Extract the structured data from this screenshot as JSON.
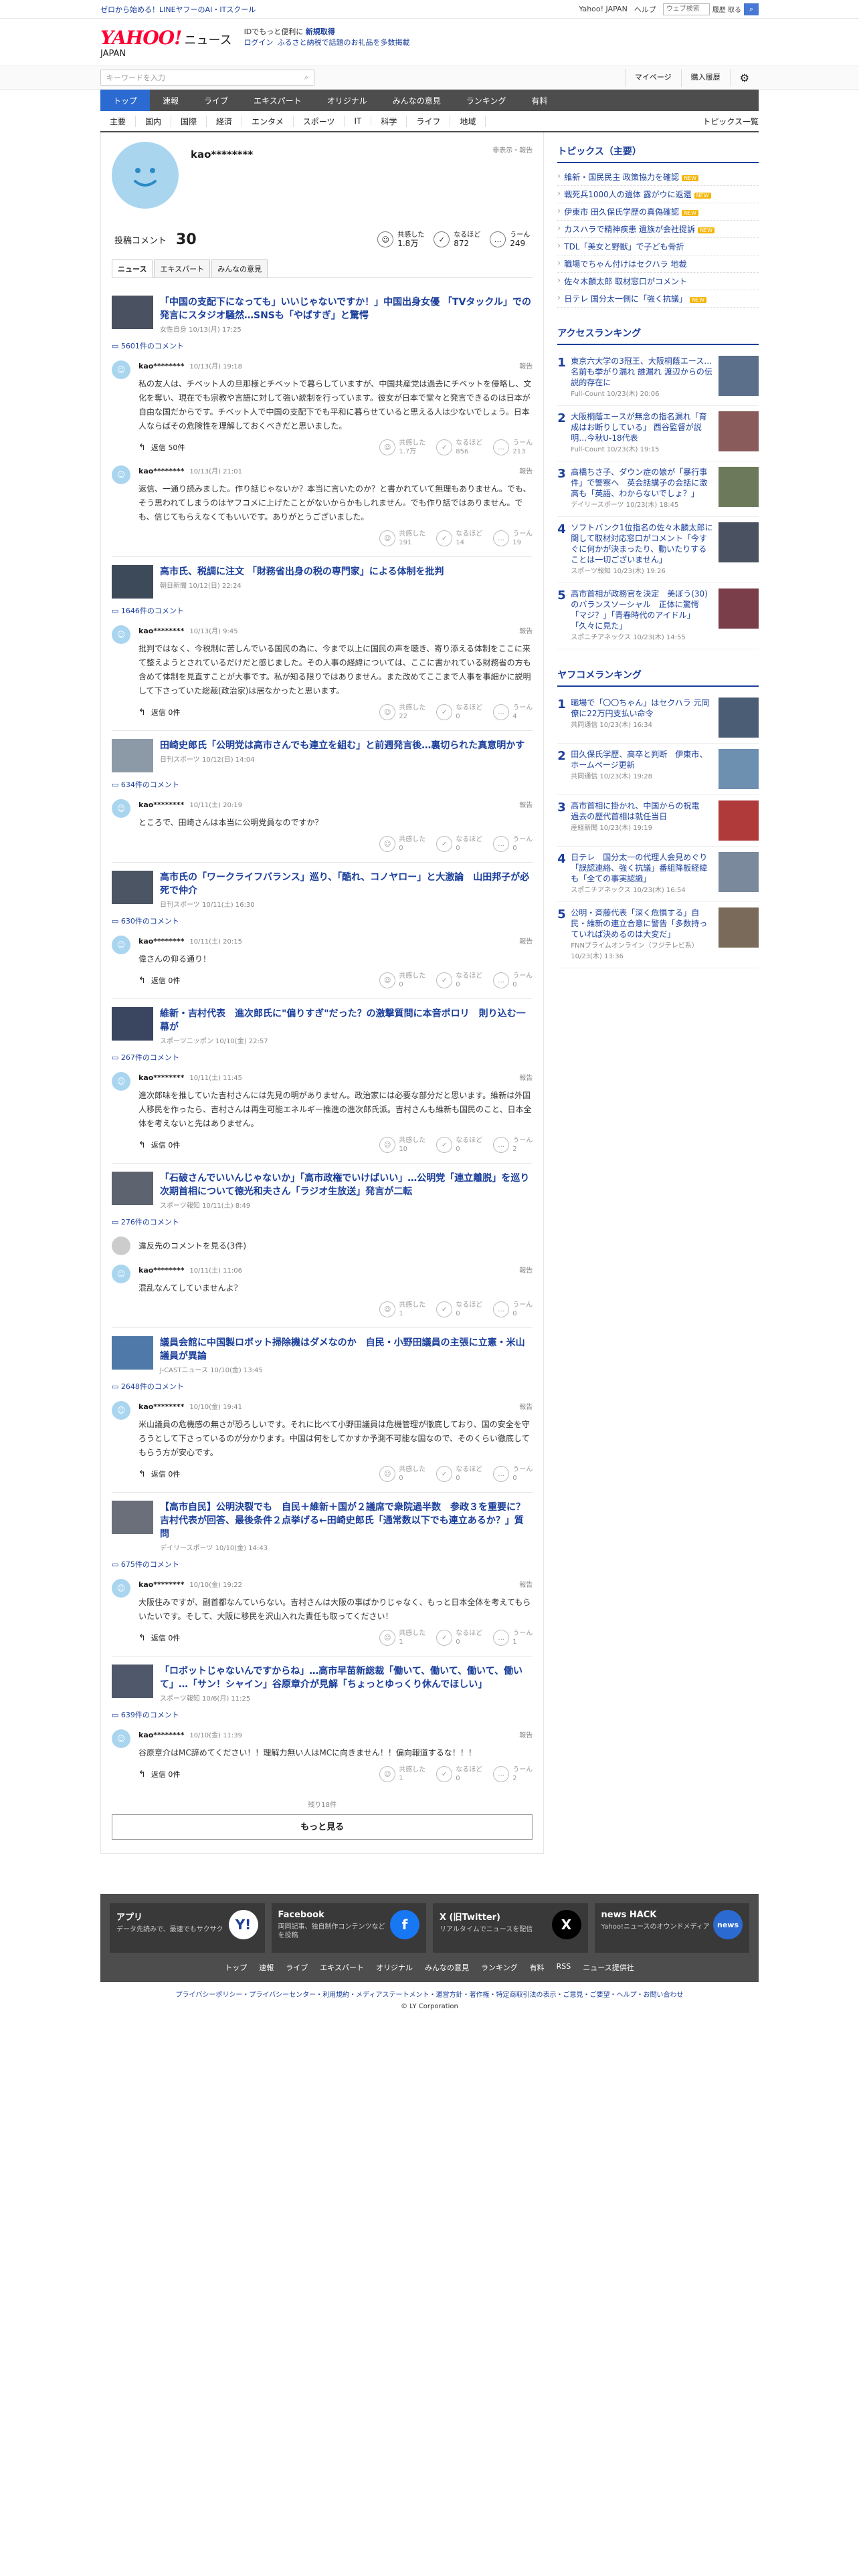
{
  "topbar": {
    "promo": "ゼロから始める！LINEヤフーのAI・ITスクール",
    "yahoo_japan": "Yahoo! JAPAN",
    "help": "ヘルプ",
    "search_placeholder": "ウェブ検索",
    "option": "履歴 取る"
  },
  "header": {
    "logo": "YAHOO!",
    "logo_sub": "JAPAN",
    "news": "ニュース",
    "promo_line1_a": "IDでもっと便利に",
    "promo_line1_b": "新規取得",
    "login": "ログイン",
    "promo_line2": "ふるさと納税で話題のお礼品を多数掲載"
  },
  "search": {
    "placeholder": "キーワードを入力",
    "mypage": "マイページ",
    "history": "購入履歴"
  },
  "nav_primary": [
    "トップ",
    "速報",
    "ライブ",
    "エキスパート",
    "オリジナル",
    "みんなの意見",
    "ランキング",
    "有料"
  ],
  "nav_secondary": [
    "主要",
    "国内",
    "国際",
    "経済",
    "エンタメ",
    "スポーツ",
    "IT",
    "科学",
    "ライフ",
    "地域"
  ],
  "nav_topics": "トピックス一覧",
  "profile": {
    "name": "kao********",
    "report": "非表示・報告",
    "posted_label": "投稿コメント",
    "posted_count": "30",
    "reactions": [
      {
        "icon": "☺",
        "label": "共感した",
        "value": "1.8万"
      },
      {
        "icon": "✓",
        "label": "なるほど",
        "value": "872"
      },
      {
        "icon": "…",
        "label": "うーん",
        "value": "249"
      }
    ],
    "tabs": [
      "ニュース",
      "エキスパート",
      "みんなの意見"
    ]
  },
  "articles": [
    {
      "title": "「中国の支配下になっても」いいじゃないですか！」中国出身女優 「TVタックル」での発言にスタジオ騒然…SNSも「やばすぎ」と驚愕",
      "meta": "女性自身 10/13(月) 17:25",
      "comment_count": "5601件のコメント",
      "comments": [
        {
          "user": "kao********",
          "time": "10/13(月) 19:18",
          "text": "私の友人は、チベット人の旦那様とチベットで暮らしていますが、中国共産党は過去にチベットを侵略し、文化を奪い、現在でも宗教や言語に対して強い統制を行っています。彼女が日本で堂々と発言できるのは日本が自由な国だからです。チベット人で中国の支配下でも平和に暮らせていると思える人は少ないでしょう。日本人ならばその危険性を理解しておくべきだと思いました。",
          "reply": "返信 50件",
          "votes": [
            {
              "l": "共感した",
              "v": "1.7万"
            },
            {
              "l": "なるほど",
              "v": "856"
            },
            {
              "l": "うーん",
              "v": "213"
            }
          ]
        },
        {
          "user": "kao********",
          "time": "10/13(月) 21:01",
          "text": "返信、一通り読みました。作り話じゃないか？本当に言いたのか？と書かれていて無理もありません。でも、そう思われてしまうのはヤフコメに上げたことがないからかもしれません。でも作り話ではありません。でも、信じてもらえなくてもいいです。ありがとうございました。",
          "reply": "",
          "votes": [
            {
              "l": "共感した",
              "v": "191"
            },
            {
              "l": "なるほど",
              "v": "14"
            },
            {
              "l": "うーん",
              "v": "19"
            }
          ]
        }
      ]
    },
    {
      "title": "高市氏、税調に注文 「財務省出身の税の専門家」による体制を批判",
      "meta": "朝日新聞 10/12(日) 22:24",
      "comment_count": "1646件のコメント",
      "comments": [
        {
          "user": "kao********",
          "time": "10/13(月) 9:45",
          "text": "批判ではなく、今税制に苦しんでいる国民の為に、今まで以上に国民の声を聴き、寄り添える体制をここに来て整えようとされているだけだと感じました。その人事の経緯については、ここに書かれている財務省の方も含めて体制を見直すことが大事です。私が知る限りではありません。また改めてここまで人事を事細かに説明して下さっていた総裁(政治家)は居なかったと思います。",
          "reply": "返信 0件",
          "votes": [
            {
              "l": "共感した",
              "v": "22"
            },
            {
              "l": "なるほど",
              "v": "0"
            },
            {
              "l": "うーん",
              "v": "4"
            }
          ]
        }
      ]
    },
    {
      "title": "田崎史郎氏「公明党は高市さんでも連立を組む」と前週発言後…裏切られた真意明かす",
      "meta": "日刊スポーツ 10/12(日) 14:04",
      "comment_count": "634件のコメント",
      "comments": [
        {
          "user": "kao********",
          "time": "10/11(土) 20:19",
          "text": "ところで、田崎さんは本当に公明党員なのですか？",
          "reply": "",
          "votes": [
            {
              "l": "共感した",
              "v": "0"
            },
            {
              "l": "なるほど",
              "v": "0"
            },
            {
              "l": "うーん",
              "v": "0"
            }
          ]
        }
      ]
    },
    {
      "title": "高市氏の「ワークライフバランス」巡り、「酷れ、コノヤロー」と大激論　山田邦子が必死で仲介",
      "meta": "日刊スポーツ 10/11(土) 16:30",
      "comment_count": "630件のコメント",
      "comments": [
        {
          "user": "kao********",
          "time": "10/11(土) 20:15",
          "text": "偉さんの仰る通り！",
          "reply": "返信 0件",
          "votes": [
            {
              "l": "共感した",
              "v": "0"
            },
            {
              "l": "なるほど",
              "v": "0"
            },
            {
              "l": "うーん",
              "v": "0"
            }
          ]
        }
      ]
    },
    {
      "title": "維新・吉村代表　進次郎氏に\"偏りすぎ\"だった？の激撃質問に本音ポロリ　則り込む一幕が",
      "meta": "スポーツニッポン 10/10(金) 22:57",
      "comment_count": "267件のコメント",
      "comments": [
        {
          "user": "kao********",
          "time": "10/11(土) 11:45",
          "text": "進次郎味を推していた吉村さんには先見の明がありません。政治家には必要な部分だと思います。維新は外国人移民を作ったら、吉村さんは再生可能エネルギー推進の進次郎氏派。吉村さんも維新も国民のこと、日本全体を考えないと先はありません。",
          "reply": "返信 0件",
          "votes": [
            {
              "l": "共感した",
              "v": "10"
            },
            {
              "l": "なるほど",
              "v": "0"
            },
            {
              "l": "うーん",
              "v": "2"
            }
          ]
        }
      ]
    },
    {
      "title": "「石破さんでいいんじゃないか」「高市政権でいけばいい」…公明党「連立離脱」を巡り次期首相について徳光和夫さん「ラジオ生放送」発言が二転",
      "meta": "スポーツ報知 10/11(土) 8:49",
      "comment_count": "276件のコメント",
      "comments": [
        {
          "user": "kao********",
          "time": "10/11(土) 11:06",
          "text": "混乱なんてしていませんよ？",
          "reply": "",
          "hidden_note": "違反先のコメントを見る(3件)",
          "votes": [
            {
              "l": "共感した",
              "v": "1"
            },
            {
              "l": "なるほど",
              "v": "0"
            },
            {
              "l": "うーん",
              "v": "0"
            }
          ]
        }
      ]
    },
    {
      "title": "議員会館に中国製ロボット掃除機はダメなのか　自民・小野田議員の主張に立憲・米山議員が異論",
      "meta": "J-CASTニュース 10/10(金) 13:45",
      "comment_count": "2648件のコメント",
      "comments": [
        {
          "user": "kao********",
          "time": "10/10(金) 19:41",
          "text": "米山議員の危機感の無さが恐ろしいです。それに比べて小野田議員は危機管理が徹底しており、国の安全を守ろうとして下さっているのが分かります。中国は何をしてかすか予測不可能な国なので、そのくらい徹底してもらう方が安心です。",
          "reply": "返信 0件",
          "votes": [
            {
              "l": "共感した",
              "v": "0"
            },
            {
              "l": "なるほど",
              "v": "0"
            },
            {
              "l": "うーん",
              "v": "0"
            }
          ]
        }
      ]
    },
    {
      "title": "【高市自民】公明決裂でも　自民＋維新＋国が２議席で衆院過半数　参政３を重要に？　吉村代表が回答、最後条件２点挙げる←田崎史郎氏「通常数以下でも連立あるか？」質問",
      "meta": "デイリースポーツ 10/10(金) 14:43",
      "comment_count": "675件のコメント",
      "comments": [
        {
          "user": "kao********",
          "time": "10/10(金) 19:22",
          "text": "大阪住みですが、副首都なんていらない。吉村さんは大阪の事ばかりじゃなく、もっと日本全体を考えてもらいたいです。そして、大阪に移民を沢山入れた責任も取ってください！",
          "reply": "返信 0件",
          "votes": [
            {
              "l": "共感した",
              "v": "1"
            },
            {
              "l": "なるほど",
              "v": "0"
            },
            {
              "l": "うーん",
              "v": "1"
            }
          ]
        }
      ]
    },
    {
      "title": "「ロボットじゃないんですからね」…高市早苗新総裁「働いて、働いて、働いて、働いて」…「サン！シャイン」谷原章介が見解「ちょっとゆっくり休んでほしい」",
      "meta": "スポーツ報知 10/6(月) 11:25",
      "comment_count": "639件のコメント",
      "comments": [
        {
          "user": "kao********",
          "time": "10/10(金) 11:39",
          "text": "谷原章介はMC辞めてください！！理解力無い人はMCに向きません！！偏向報道するな！！！",
          "reply": "返信 0件",
          "votes": [
            {
              "l": "共感した",
              "v": "1"
            },
            {
              "l": "なるほど",
              "v": "0"
            },
            {
              "l": "うーん",
              "v": "2"
            }
          ]
        }
      ]
    }
  ],
  "more": {
    "remaining": "残り18件",
    "button": "もっと見る"
  },
  "sidebar": {
    "topics_title": "トピックス（主要）",
    "topics": [
      {
        "t": "維新・国民民主 政策協力を確認",
        "new": true
      },
      {
        "t": "戦死兵1000人の遺体 露がウに返還",
        "new": true
      },
      {
        "t": "伊東市 田久保氏学歴の真偽確認",
        "new": true
      },
      {
        "t": "カスハラで精神疾患 遺族が会社提訴",
        "new": true
      },
      {
        "t": "TDL「美女と野獣」で子ども骨折",
        "new": false
      },
      {
        "t": "職場でちゃん付けはセクハラ 地裁",
        "new": false
      },
      {
        "t": "佐々木麟太郎 取材窓口がコメント",
        "new": false
      },
      {
        "t": "日テレ 国分太一側に「強く抗議」",
        "new": true
      }
    ],
    "access_title": "アクセスランキング",
    "access": [
      {
        "n": "1",
        "t": "東京六大学の3冠王、大阪桐蔭エース…名前も挙がり漏れ 誰漏れ 渡辺からの伝説的存在に",
        "s": "Full-Count 10/23(木) 20:06"
      },
      {
        "n": "2",
        "t": "大阪桐蔭エースが無念の指名漏れ「育成はお断りしている」 西谷監督が説明…今秋U-18代表",
        "s": "Full-Count 10/23(木) 19:15"
      },
      {
        "n": "3",
        "t": "高橋ちさ子、ダウン症の娘が「暴行事件」で警察へ　英会話講子の会話に激高も「英語、わからないでしょ？」",
        "s": "デイリースポーツ 10/23(木) 18:45"
      },
      {
        "n": "4",
        "t": "ソフトバンク1位指名の佐々木麟太郎に関して取材対応窓口がコメント「今すぐに何かが決まったり、動いたりすることは一切ございません」",
        "s": "スポーツ報知 10/23(木) 19:26"
      },
      {
        "n": "5",
        "t": "高市首相が政務官を決定　美ぼう(30)のバランスソーシャル　正体に驚愕「マジ？」「青春時代のアイドル」「久々に見た」",
        "s": "スポニチアネックス 10/23(木) 14:55"
      }
    ],
    "yafu_title": "ヤフコメランキング",
    "yafu": [
      {
        "n": "1",
        "t": "職場で「〇〇ちゃん」はセクハラ 元同僚に22万円支払い命令",
        "s": "共同通信 10/23(木) 16:34"
      },
      {
        "n": "2",
        "t": "田久保氏学歴、高卒と判断　伊東市、ホームページ更新",
        "s": "共同通信 10/23(木) 19:28"
      },
      {
        "n": "3",
        "t": "高市首相に掛かれ、中国からの祝電　過去の歴代首相は就任当日",
        "s": "産経新聞 10/23(木) 19:19"
      },
      {
        "n": "4",
        "t": "日テレ　国分太一の代理人会見めぐり「誤認連絡、強く抗議」番組降板経緯も「全ての事実認識」",
        "s": "スポニチアネックス 10/23(木) 16:54"
      },
      {
        "n": "5",
        "t": "公明・斉藤代表「深く危惧する」自民・維新の連立合意に警告「多数持っていれば決めるのは大変だ」",
        "s": "FNNプライムオンライン（フジテレビ系） 10/23(木) 13:36"
      }
    ]
  },
  "footer": {
    "cards": [
      {
        "h": "アプリ",
        "d": "データ先読みで、最速でもサクサク",
        "ic": "Y!",
        "c": "#ffffff",
        "fg": "#1a3e9b"
      },
      {
        "h": "Facebook",
        "d": "両同記事、独自制作コンテンツなどを投稿",
        "ic": "f",
        "c": "#1877f2",
        "fg": "#ffffff"
      },
      {
        "h": "X (旧Twitter)",
        "d": "リアルタイムでニュースを配信",
        "ic": "X",
        "c": "#000000",
        "fg": "#ffffff"
      },
      {
        "h": "news HACK",
        "d": "Yahoo!ニュースのオウンドメディア",
        "ic": "news",
        "c": "#2b6bd1",
        "fg": "#ffffff"
      }
    ],
    "nav": [
      "トップ",
      "速報",
      "ライブ",
      "エキスパート",
      "オリジナル",
      "みんなの意見",
      "ランキング",
      "有料",
      "RSS",
      "ニュース提供社"
    ],
    "links": "プライバシーポリシー・プライバシーセンター・利用規約・メディアステートメント・運営方針・著作権・特定商取引法の表示・ご意見・ご要望・ヘルプ・お問い合わせ",
    "copyright": "© LY Corporation"
  }
}
